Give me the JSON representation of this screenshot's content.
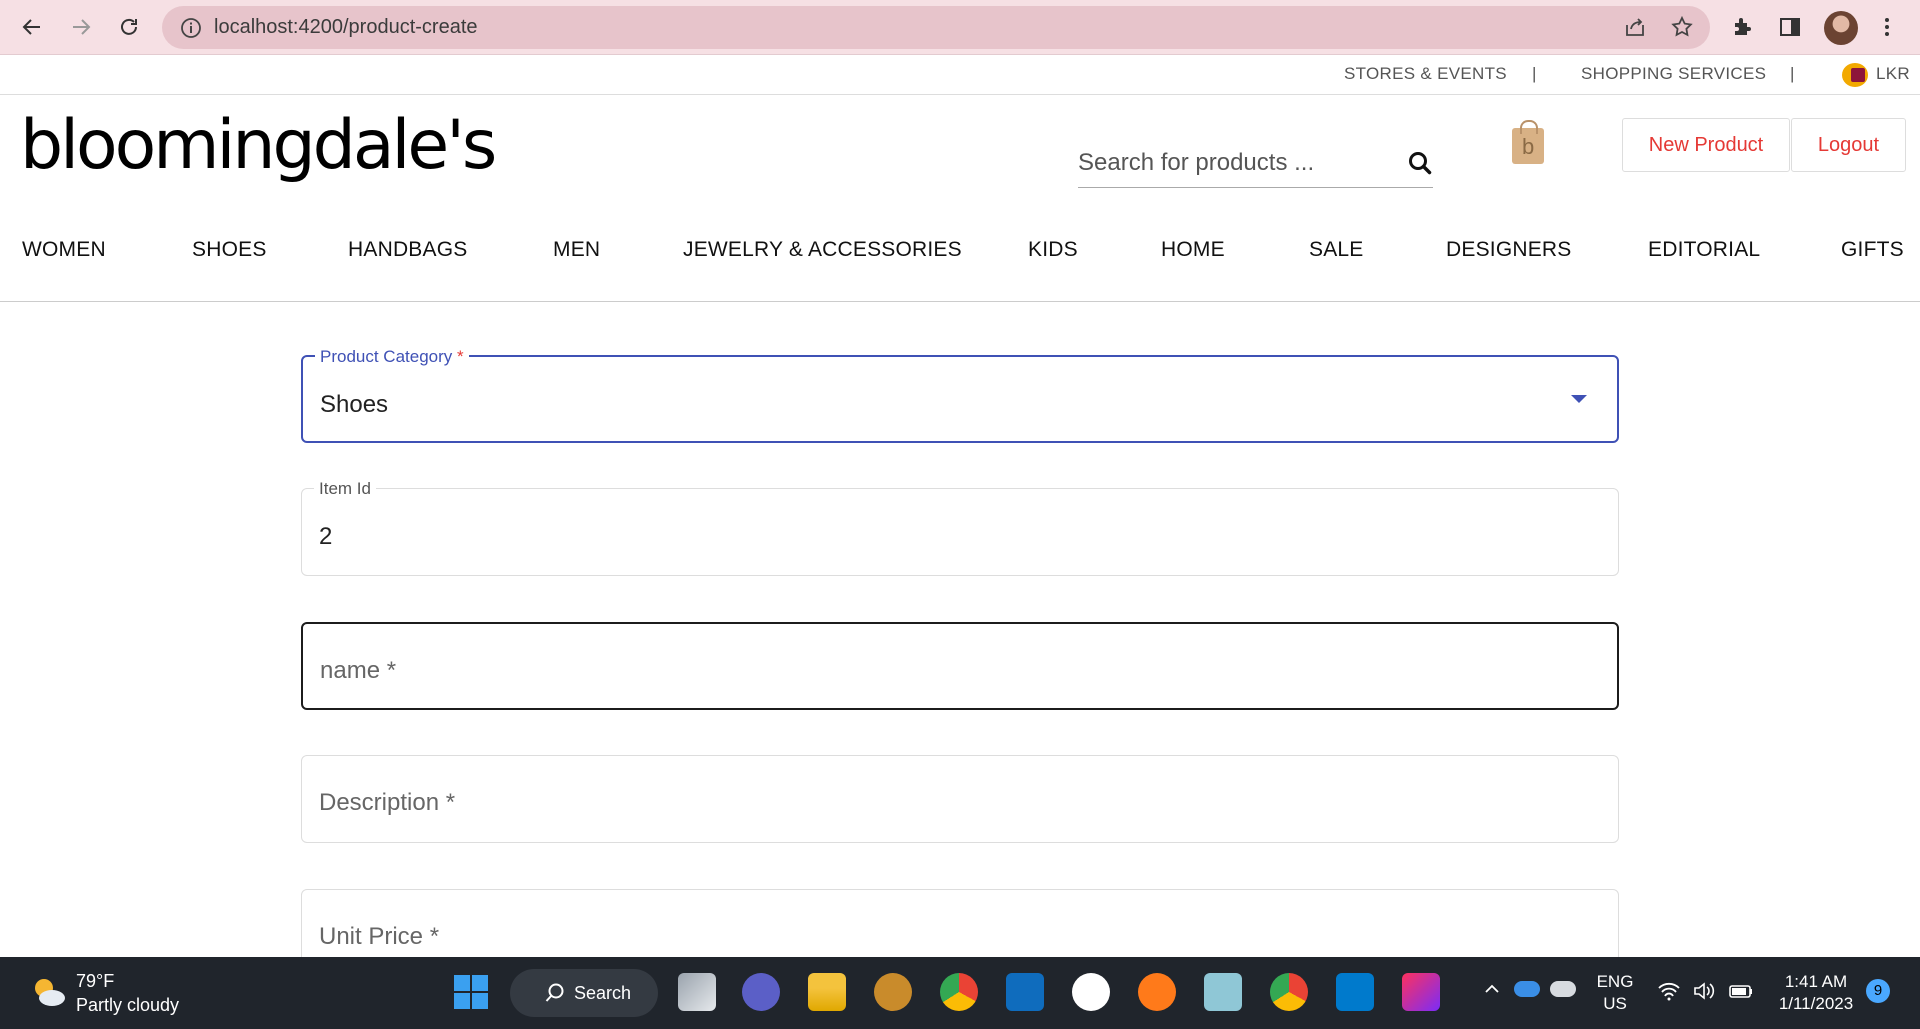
{
  "browser": {
    "url": "localhost:4200/product-create"
  },
  "utility_bar": {
    "links": [
      "STORES & EVENTS",
      "SHOPPING SERVICES"
    ],
    "separator": "|",
    "currency": "LKR"
  },
  "header": {
    "logo": "bloomingdale's",
    "search_placeholder": "Search for products ...",
    "bag_letter": "b",
    "new_product_label": "New Product",
    "logout_label": "Logout"
  },
  "categories": [
    "WOMEN",
    "SHOES",
    "HANDBAGS",
    "MEN",
    "JEWELRY & ACCESSORIES",
    "KIDS",
    "HOME",
    "SALE",
    "DESIGNERS",
    "EDITORIAL",
    "GIFTS"
  ],
  "form": {
    "category": {
      "label": "Product Category",
      "required_mark": "*",
      "value": "Shoes"
    },
    "item_id": {
      "label": "Item Id",
      "value": "2"
    },
    "name": {
      "placeholder": "name *"
    },
    "description": {
      "placeholder": "Description *"
    },
    "unit_price": {
      "placeholder": "Unit Price *"
    }
  },
  "taskbar": {
    "temperature": "79°F",
    "condition": "Partly cloudy",
    "search_label": "Search",
    "lang_top": "ENG",
    "lang_bottom": "US",
    "time": "1:41 AM",
    "date": "1/11/2023",
    "notification_count": "9"
  },
  "colors": {
    "accent": "#3f51b5",
    "danger": "#e53935",
    "chrome_bg": "#f6e0e4",
    "taskbar_bg": "#20252c"
  }
}
